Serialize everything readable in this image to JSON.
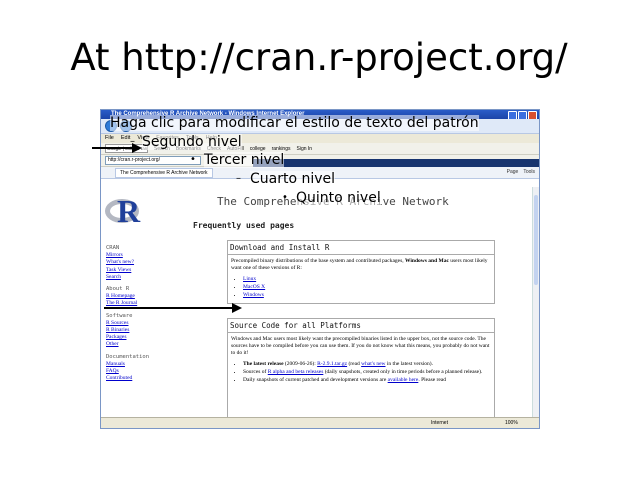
{
  "slide": {
    "title": "At http://cran.r-project.org/"
  },
  "browser": {
    "window_title": "The Comprehensive R Archive Network - Windows Internet Explorer",
    "menu": [
      "File",
      "Edit",
      "View",
      "Favorites",
      "Tools",
      "Help"
    ],
    "google_search_text": "Google | college rankings",
    "toolbar_items": [
      "Search",
      "Bookmarks",
      "Check",
      "AutoFill",
      "college",
      "rankings",
      "Sign In"
    ],
    "address": "http://cran.r-project.org/",
    "sports_items": [
      "News",
      "Entertainment",
      "Video",
      "Sports",
      "Money",
      "Autos"
    ],
    "tab_label": "The Comprehensive R Archive Network",
    "tab_tools": [
      "Page",
      "Tools"
    ],
    "status_zone": "Internet",
    "status_zoom": "100%"
  },
  "page": {
    "heading": "The Comprehensive R Archive Network",
    "frequently_used": "Frequently used pages",
    "nav": {
      "cran_title": "CRAN",
      "cran_links": [
        "Mirrors",
        "What's new?",
        "Task Views",
        "Search"
      ],
      "about_title": "About R",
      "about_links": [
        "R Homepage",
        "The R Journal"
      ],
      "software_title": "Software",
      "software_links": [
        "R Sources",
        "R Binaries",
        "Packages",
        "Other"
      ],
      "doc_title": "Documentation",
      "doc_links": [
        "Manuals",
        "FAQs",
        "Contributed"
      ]
    },
    "download_box": {
      "title": "Download and Install R",
      "text_1": "Precompiled binary distributions of the base system and contributed packages, ",
      "text_bold": "Windows and Mac",
      "text_2": " users most likely want one of these versions of R:",
      "links": [
        "Linux",
        "MacOS X",
        "Windows"
      ]
    },
    "source_box": {
      "title": "Source Code for all Platforms",
      "text": "Windows and Mac users most likely want the precompiled binaries listed in the upper box, not the source code. The sources have to be compiled before you can use them. If you do not know what this means, you probably do not want to do it!",
      "item1_bold": "The latest release",
      "item1_date": " (2009-06-26): ",
      "item1_link": "R-2.9.1.tar.gz",
      "item1_mid": " (read ",
      "item1_link2": "what's new",
      "item1_end": " in the latest version).",
      "item2_start": "Sources of ",
      "item2_link": "R alpha and beta releases",
      "item2_end": " (daily snapshots, created only in time periods before a planned release).",
      "item3_start": "Daily snapshots of current patched and development versions are ",
      "item3_link": "available here",
      "item3_end": ". Please read"
    }
  },
  "overlay": {
    "level1": "Haga clic para modificar el estilo de texto del patrón",
    "level2": "Segundo nivel",
    "level3": "Tercer nivel",
    "level4": "Cuarto nivel",
    "level5": "Quinto nivel"
  }
}
